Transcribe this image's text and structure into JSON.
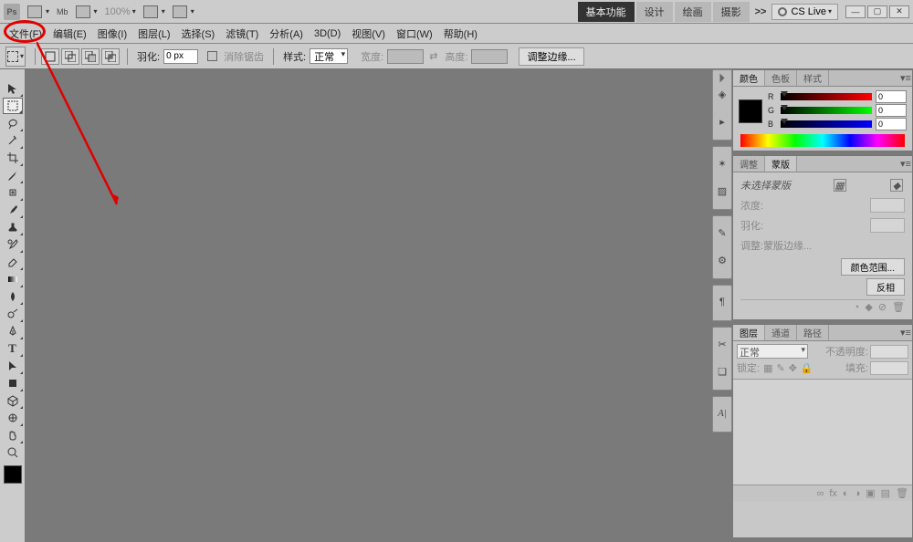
{
  "topbar": {
    "logo": "Ps",
    "zoom": "100%",
    "workspaces": [
      "基本功能",
      "设计",
      "绘画",
      "摄影"
    ],
    "more": ">>",
    "cslive": "CS Live"
  },
  "menu": {
    "items": [
      "文件(F)",
      "编辑(E)",
      "图像(I)",
      "图层(L)",
      "选择(S)",
      "滤镜(T)",
      "分析(A)",
      "3D(D)",
      "视图(V)",
      "窗口(W)",
      "帮助(H)"
    ]
  },
  "options": {
    "feather_label": "羽化:",
    "feather_value": "0 px",
    "antialias_label": "消除锯齿",
    "style_label": "样式:",
    "style_value": "正常",
    "width_label": "宽度:",
    "height_label": "高度:",
    "refine_btn": "调整边缘..."
  },
  "color_panel": {
    "tabs": [
      "颜色",
      "色板",
      "样式"
    ],
    "channels": [
      {
        "label": "R",
        "value": "0"
      },
      {
        "label": "G",
        "value": "0"
      },
      {
        "label": "B",
        "value": "0"
      }
    ]
  },
  "mask_panel": {
    "tabs": [
      "调整",
      "蒙版"
    ],
    "msg": "未选择蒙版",
    "density_label": "浓度:",
    "feather_label": "羽化:",
    "adjust_label": "调整:",
    "btn_mask_edge": "蒙版边缘...",
    "btn_color_range": "颜色范围...",
    "btn_invert": "反相"
  },
  "layers_panel": {
    "tabs": [
      "图层",
      "通道",
      "路径"
    ],
    "blend_value": "正常",
    "opacity_label": "不透明度:",
    "lock_label": "锁定:",
    "fill_label": "填充:"
  }
}
